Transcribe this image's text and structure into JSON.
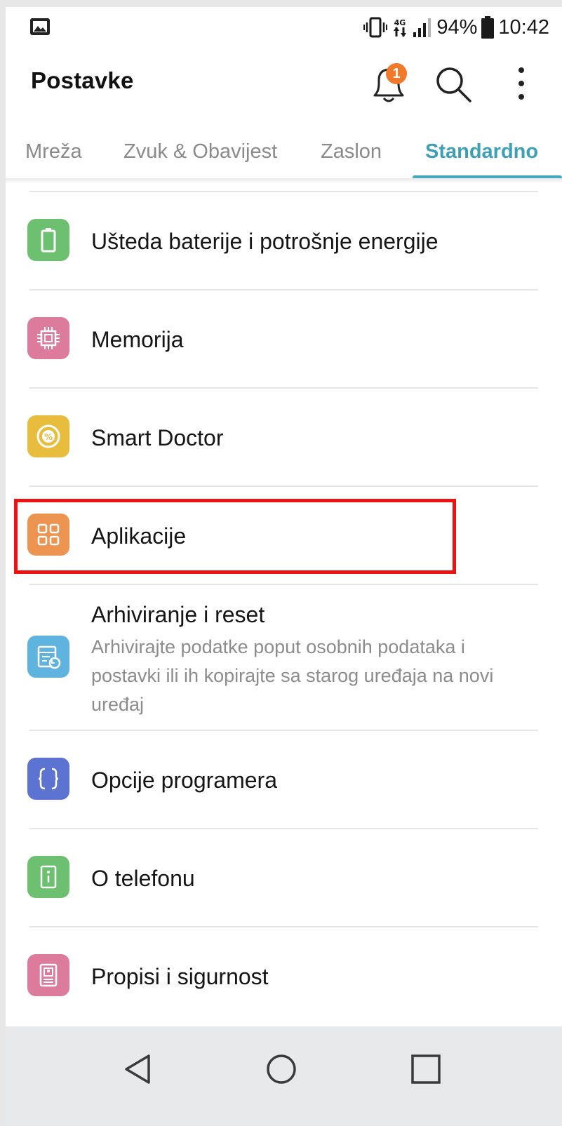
{
  "status_bar": {
    "gallery_icon": "image-icon",
    "vibrate_icon": "vibrate-icon",
    "network_label": "4G",
    "signal_icon": "signal-icon",
    "battery_percent": "94%",
    "battery_icon": "battery-icon",
    "time": "10:42"
  },
  "header": {
    "title": "Postavke",
    "notification_count": "1",
    "bell_icon": "bell-icon",
    "search_icon": "search-icon",
    "more_icon": "more-vert-icon"
  },
  "tabs": [
    {
      "label": "Mreža",
      "active": false
    },
    {
      "label": "Zvuk & Obavijest",
      "active": false
    },
    {
      "label": "Zaslon",
      "active": false
    },
    {
      "label": "Standardno",
      "active": true
    }
  ],
  "settings": {
    "items": [
      {
        "label": "Ušteda baterije i potrošnje energije",
        "icon": "battery-icon",
        "color": "#6cc070"
      },
      {
        "label": "Memorija",
        "icon": "chip-icon",
        "color": "#dc7b9b"
      },
      {
        "label": "Smart Doctor",
        "icon": "smart-doctor-icon",
        "color": "#e8bd3e"
      },
      {
        "label": "Aplikacije",
        "icon": "apps-grid-icon",
        "color": "#ec9450",
        "highlighted": true
      },
      {
        "label": "Arhiviranje i reset",
        "description": "Arhivirajte podatke poput osobnih podataka i postavki ili ih kopirajte sa starog uređaja na novi uređaj",
        "icon": "backup-icon",
        "color": "#5fb3df"
      },
      {
        "label": "Opcije programera",
        "icon": "braces-icon",
        "color": "#5d73d2"
      },
      {
        "label": "O telefonu",
        "icon": "info-icon",
        "color": "#6cc070"
      },
      {
        "label": "Propisi i sigurnost",
        "icon": "certificate-icon",
        "color": "#dc7b9b"
      }
    ]
  },
  "nav_bar": {
    "back_icon": "back-triangle-icon",
    "home_icon": "home-circle-icon",
    "recents_icon": "recents-square-icon"
  }
}
